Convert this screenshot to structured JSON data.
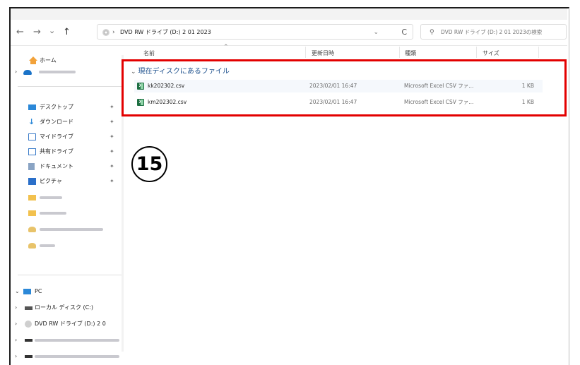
{
  "address_bar": {
    "path": "DVD RW ドライブ (D:) 2 01 2023",
    "search_placeholder": "DVD RW ドライブ (D:) 2 01 2023の検索"
  },
  "nav": {
    "back": "←",
    "forward": "→",
    "recent": "⌄",
    "up": "↑",
    "separator": "›",
    "dropdown": "⌄",
    "refresh": "C",
    "search_icon": "⚲"
  },
  "sidebar": {
    "home": "ホーム",
    "quick_access": [
      {
        "label": "デスクトップ",
        "icon": "desktop-icon",
        "color": "#2b88d8"
      },
      {
        "label": "ダウンロード",
        "icon": "download-icon",
        "color": "#2b88d8"
      },
      {
        "label": "マイドライブ",
        "icon": "drive-icon",
        "color": "#3d7dca"
      },
      {
        "label": "共有ドライブ",
        "icon": "shared-drive-icon",
        "color": "#3d7dca"
      },
      {
        "label": "ドキュメント",
        "icon": "documents-icon",
        "color": "#6e8fb5"
      },
      {
        "label": "ピクチャ",
        "icon": "pictures-icon",
        "color": "#2a6fc9"
      }
    ],
    "pin_glyph": "✦",
    "pc": "PC",
    "drives": [
      {
        "label": "ローカル ディスク (C:)",
        "icon": "local-disk-icon"
      },
      {
        "label": "DVD RW ドライブ (D:) 2 0",
        "icon": "dvd-drive-icon"
      }
    ]
  },
  "columns": {
    "name": "名前",
    "modified": "更新日時",
    "type": "種類",
    "size": "サイズ"
  },
  "group_header": "現在ディスクにあるファイル",
  "files": [
    {
      "name": "kk202302.csv",
      "modified": "2023/02/01 16:47",
      "type": "Microsoft Excel CSV ファ...",
      "size": "1 KB"
    },
    {
      "name": "km202302.csv",
      "modified": "2023/02/01 16:47",
      "type": "Microsoft Excel CSV ファ...",
      "size": "1 KB"
    }
  ],
  "step_badge": "15",
  "colors": {
    "highlight_box": "#e30000",
    "group_header": "#1c4f8c",
    "excel_green": "#1d6f42"
  }
}
